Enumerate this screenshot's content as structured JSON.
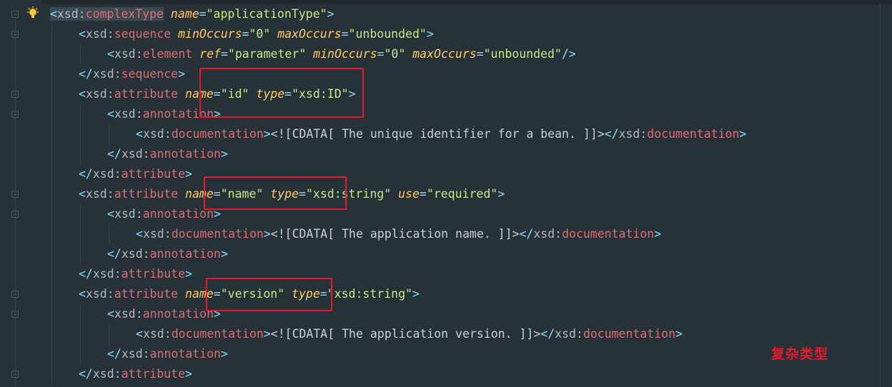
{
  "editor": {
    "lines": [
      {
        "segs": [
          [
            "p",
            "<"
          ],
          [
            "pre",
            "xsd:"
          ],
          [
            "t",
            "complexType"
          ],
          [
            "txt",
            " "
          ],
          [
            "an",
            "name"
          ],
          [
            "eq",
            "="
          ],
          [
            "v",
            "\"applicationType\""
          ],
          [
            "p",
            ">"
          ]
        ]
      },
      {
        "segs": [
          [
            "p",
            "<"
          ],
          [
            "pre",
            "xsd:"
          ],
          [
            "t",
            "sequence"
          ],
          [
            "txt",
            " "
          ],
          [
            "an",
            "minOccurs"
          ],
          [
            "eq",
            "="
          ],
          [
            "v",
            "\"0\""
          ],
          [
            "txt",
            " "
          ],
          [
            "an",
            "maxOccurs"
          ],
          [
            "eq",
            "="
          ],
          [
            "v",
            "\"unbounded\""
          ],
          [
            "p",
            ">"
          ]
        ]
      },
      {
        "segs": [
          [
            "p",
            "<"
          ],
          [
            "pre",
            "xsd:"
          ],
          [
            "t",
            "element"
          ],
          [
            "txt",
            " "
          ],
          [
            "an",
            "ref"
          ],
          [
            "eq",
            "="
          ],
          [
            "v",
            "\"parameter\""
          ],
          [
            "txt",
            " "
          ],
          [
            "an",
            "minOccurs"
          ],
          [
            "eq",
            "="
          ],
          [
            "v",
            "\"0\""
          ],
          [
            "txt",
            " "
          ],
          [
            "an",
            "maxOccurs"
          ],
          [
            "eq",
            "="
          ],
          [
            "v",
            "\"unbounded\""
          ],
          [
            "p",
            "/>"
          ]
        ]
      },
      {
        "segs": [
          [
            "p",
            "</"
          ],
          [
            "pre",
            "xsd:"
          ],
          [
            "t",
            "sequence"
          ],
          [
            "p",
            ">"
          ]
        ]
      },
      {
        "segs": [
          [
            "p",
            "<"
          ],
          [
            "pre",
            "xsd:"
          ],
          [
            "t",
            "attribute"
          ],
          [
            "txt",
            " "
          ],
          [
            "an",
            "name"
          ],
          [
            "eq",
            "="
          ],
          [
            "v",
            "\"id\""
          ],
          [
            "txt",
            " "
          ],
          [
            "an",
            "type"
          ],
          [
            "eq",
            "="
          ],
          [
            "v",
            "\"xsd:ID\""
          ],
          [
            "p",
            ">"
          ]
        ]
      },
      {
        "segs": [
          [
            "p",
            "<"
          ],
          [
            "pre",
            "xsd:"
          ],
          [
            "t",
            "annotation"
          ],
          [
            "p",
            ">"
          ]
        ]
      },
      {
        "segs": [
          [
            "p",
            "<"
          ],
          [
            "pre",
            "xsd:"
          ],
          [
            "t",
            "documentation"
          ],
          [
            "p",
            ">"
          ],
          [
            "txt",
            "<![CDATA[ The unique identifier for a bean. ]]>"
          ],
          [
            "p",
            "</"
          ],
          [
            "pre",
            "xsd:"
          ],
          [
            "t",
            "documentation"
          ],
          [
            "p",
            ">"
          ]
        ]
      },
      {
        "segs": [
          [
            "p",
            "</"
          ],
          [
            "pre",
            "xsd:"
          ],
          [
            "t",
            "annotation"
          ],
          [
            "p",
            ">"
          ]
        ]
      },
      {
        "segs": [
          [
            "p",
            "</"
          ],
          [
            "pre",
            "xsd:"
          ],
          [
            "t",
            "attribute"
          ],
          [
            "p",
            ">"
          ]
        ]
      },
      {
        "segs": [
          [
            "p",
            "<"
          ],
          [
            "pre",
            "xsd:"
          ],
          [
            "t",
            "attribute"
          ],
          [
            "txt",
            " "
          ],
          [
            "an",
            "name"
          ],
          [
            "eq",
            "="
          ],
          [
            "v",
            "\"name\""
          ],
          [
            "txt",
            " "
          ],
          [
            "an",
            "type"
          ],
          [
            "eq",
            "="
          ],
          [
            "v",
            "\"xsd:string\""
          ],
          [
            "txt",
            " "
          ],
          [
            "an",
            "use"
          ],
          [
            "eq",
            "="
          ],
          [
            "v",
            "\"required\""
          ],
          [
            "p",
            ">"
          ]
        ]
      },
      {
        "segs": [
          [
            "p",
            "<"
          ],
          [
            "pre",
            "xsd:"
          ],
          [
            "t",
            "annotation"
          ],
          [
            "p",
            ">"
          ]
        ]
      },
      {
        "segs": [
          [
            "p",
            "<"
          ],
          [
            "pre",
            "xsd:"
          ],
          [
            "t",
            "documentation"
          ],
          [
            "p",
            ">"
          ],
          [
            "txt",
            "<![CDATA[ The application name. ]]>"
          ],
          [
            "p",
            "</"
          ],
          [
            "pre",
            "xsd:"
          ],
          [
            "t",
            "documentation"
          ],
          [
            "p",
            ">"
          ]
        ]
      },
      {
        "segs": [
          [
            "p",
            "</"
          ],
          [
            "pre",
            "xsd:"
          ],
          [
            "t",
            "annotation"
          ],
          [
            "p",
            ">"
          ]
        ]
      },
      {
        "segs": [
          [
            "p",
            "</"
          ],
          [
            "pre",
            "xsd:"
          ],
          [
            "t",
            "attribute"
          ],
          [
            "p",
            ">"
          ]
        ]
      },
      {
        "segs": [
          [
            "p",
            "<"
          ],
          [
            "pre",
            "xsd:"
          ],
          [
            "t",
            "attribute"
          ],
          [
            "txt",
            " "
          ],
          [
            "an",
            "name"
          ],
          [
            "eq",
            "="
          ],
          [
            "v",
            "\"version\""
          ],
          [
            "txt",
            " "
          ],
          [
            "an",
            "type"
          ],
          [
            "eq",
            "="
          ],
          [
            "v",
            "\"xsd:string\""
          ],
          [
            "p",
            ">"
          ]
        ]
      },
      {
        "segs": [
          [
            "p",
            "<"
          ],
          [
            "pre",
            "xsd:"
          ],
          [
            "t",
            "annotation"
          ],
          [
            "p",
            ">"
          ]
        ]
      },
      {
        "segs": [
          [
            "p",
            "<"
          ],
          [
            "pre",
            "xsd:"
          ],
          [
            "t",
            "documentation"
          ],
          [
            "p",
            ">"
          ],
          [
            "txt",
            "<![CDATA[ The application version. ]]>"
          ],
          [
            "p",
            "</"
          ],
          [
            "pre",
            "xsd:"
          ],
          [
            "t",
            "documentation"
          ],
          [
            "p",
            ">"
          ]
        ]
      },
      {
        "segs": [
          [
            "p",
            "</"
          ],
          [
            "pre",
            "xsd:"
          ],
          [
            "t",
            "annotation"
          ],
          [
            "p",
            ">"
          ]
        ]
      },
      {
        "segs": [
          [
            "p",
            "</"
          ],
          [
            "pre",
            "xsd:"
          ],
          [
            "t",
            "attribute"
          ],
          [
            "p",
            ">"
          ]
        ]
      }
    ]
  },
  "annotation_text": "复杂类型",
  "icons": {
    "intention_bulb": "lightbulb-icon"
  },
  "colors": {
    "background": "#263238",
    "tag": "#e06c75",
    "attribute_name": "#ffcb6b",
    "attribute_value": "#c3e88d",
    "highlight_box": "#e8192c"
  }
}
